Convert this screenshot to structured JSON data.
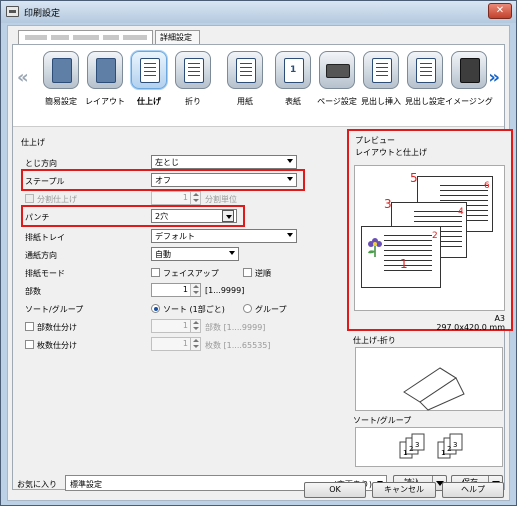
{
  "window": {
    "title": "印刷設定",
    "close_label": "✕"
  },
  "tabs": {
    "detail": "詳細設定"
  },
  "iconbar": {
    "items": [
      {
        "id": "easy",
        "label": "簡易設定",
        "icon": "easy-setup-icon"
      },
      {
        "id": "layout",
        "label": "レイアウト",
        "icon": "layout-icon"
      },
      {
        "id": "finishing",
        "label": "仕上げ",
        "icon": "finishing-icon",
        "selected": true
      },
      {
        "id": "fold",
        "label": "折り",
        "icon": "fold-icon"
      },
      {
        "id": "paper",
        "label": "用紙",
        "icon": "paper-icon"
      },
      {
        "id": "cover",
        "label": "表紙",
        "icon": "cover-icon"
      },
      {
        "id": "page",
        "label": "ページ設定",
        "icon": "page-setup-icon"
      },
      {
        "id": "tab_insert",
        "label": "見出し挿入",
        "icon": "tab-insert-icon"
      },
      {
        "id": "tab_setting",
        "label": "見出し設定",
        "icon": "tab-setting-icon"
      },
      {
        "id": "image",
        "label": "イメージング",
        "icon": "imaging-icon"
      }
    ],
    "cover_number": "1"
  },
  "finishing": {
    "section_title": "仕上げ",
    "binding": {
      "label": "とじ方向",
      "value": "左とじ"
    },
    "staple": {
      "label": "ステープル",
      "value": "オフ"
    },
    "split": {
      "label": "分割仕上げ",
      "value": "1",
      "suffix": "分割単位",
      "checked": false,
      "disabled": true
    },
    "punch": {
      "label": "パンチ",
      "value": "2穴"
    },
    "output_tray": {
      "label": "排紙トレイ",
      "value": "デフォルト"
    },
    "feed_direction": {
      "label": "通紙方向",
      "value": "自動"
    },
    "output_mode": {
      "label": "排紙モード",
      "faceup": "フェイスアップ",
      "reverse": "逆順"
    },
    "copies": {
      "label": "部数",
      "value": "1",
      "range": "[1...9999]"
    },
    "sort_group": {
      "label": "ソート/グループ",
      "sort": "ソート (1部ごと)",
      "group": "グループ",
      "selected": "sort"
    },
    "copy_split": {
      "label": "部数仕分け",
      "value": "1",
      "suffix": "部数 [1....9999]"
    },
    "sheet_split": {
      "label": "枚数仕分け",
      "value": "1",
      "suffix": "枚数 [1....65535]"
    }
  },
  "preview": {
    "title": "プレビュー",
    "subtitle": "レイアウトと仕上げ",
    "page_numbers": [
      "1",
      "2",
      "3",
      "4",
      "5",
      "6"
    ],
    "paper_size": "A3",
    "paper_dims": "297.0x420.0 mm",
    "fold_title": "仕上げ-折り",
    "sort_title": "ソート/グループ",
    "sort_pages": [
      "1",
      "2",
      "3"
    ]
  },
  "footer": {
    "favorites_label": "お気に入り",
    "favorites_value": "標準設定",
    "changed_label": "(変更あり)",
    "load_label": "読込",
    "save_label": "保存",
    "ok_label": "OK",
    "cancel_label": "キャンセル",
    "help_label": "ヘルプ"
  },
  "colors": {
    "highlight": "#e0191b",
    "accent": "#1463c7",
    "number_red": "#d22222"
  }
}
